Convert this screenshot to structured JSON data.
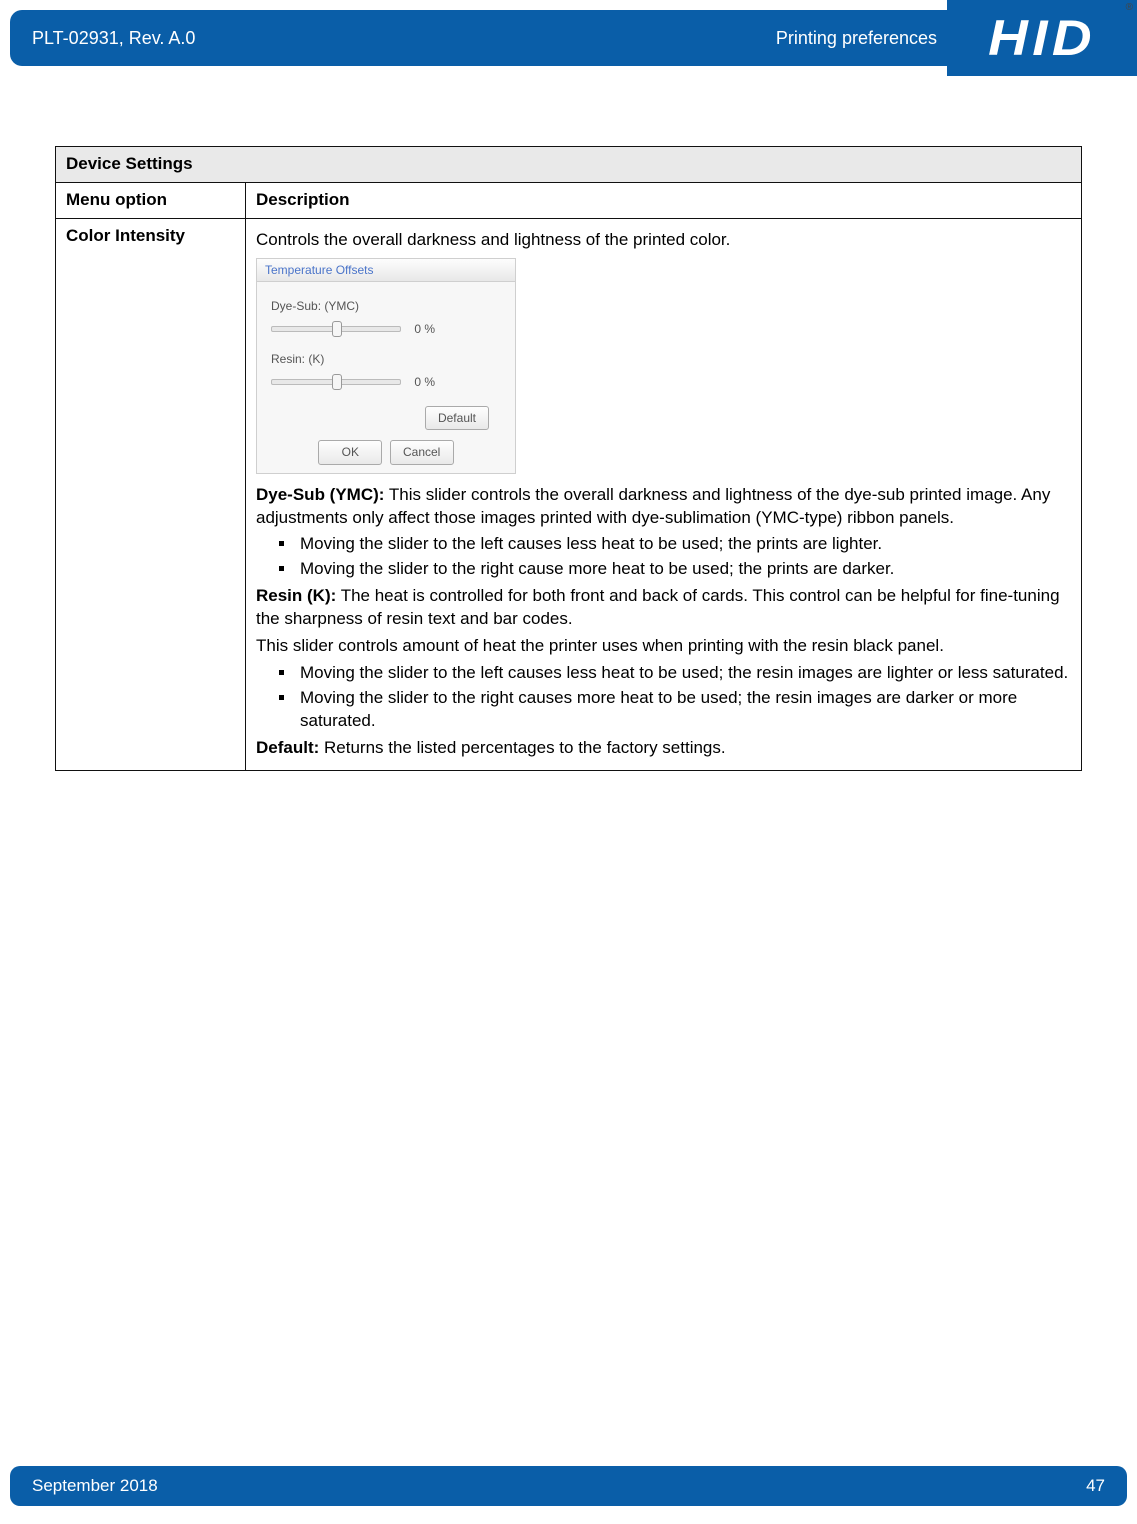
{
  "header": {
    "doc_id": "PLT-02931, Rev. A.0",
    "section": "Printing preferences",
    "logo_text": "HID",
    "reg_mark": "®"
  },
  "table": {
    "title": "Device Settings",
    "col1": "Menu option",
    "col2": "Description",
    "row": {
      "menu": "Color Intensity",
      "intro": "Controls the overall darkness and lightness of the printed color.",
      "dialog": {
        "title": "Temperature Offsets",
        "slider1_label": "Dye-Sub: (YMC)",
        "slider1_value": "0  %",
        "slider2_label": "Resin: (K)",
        "slider2_value": "0  %",
        "default_btn": "Default",
        "ok_btn": "OK",
        "cancel_btn": "Cancel"
      },
      "dyesub_label": "Dye-Sub (YMC):",
      "dyesub_text": " This slider controls the overall darkness and lightness of the dye-sub printed image. Any adjustments only affect those images printed with dye-sublimation (YMC-type) ribbon panels.",
      "dyesub_b1": "Moving the slider to the left causes less heat to be used; the prints are lighter.",
      "dyesub_b2": "Moving the slider to the right cause more heat to be used; the prints are darker.",
      "resin_label": "Resin (K):",
      "resin_text": " The heat is controlled for both front and back of cards. This control can be helpful for fine-tuning the sharpness of resin text and bar codes.",
      "resin_text2": "This slider controls amount of heat the printer uses when printing with the resin black panel.",
      "resin_b1": "Moving the slider to the left causes less heat to be used; the resin images are lighter or less saturated.",
      "resin_b2": "Moving the slider to the right causes more heat to be used; the resin images are darker or more saturated.",
      "default_label": "Default:",
      "default_text": " Returns the listed percentages to the factory settings."
    }
  },
  "footer": {
    "date": "September 2018",
    "page": "47"
  }
}
